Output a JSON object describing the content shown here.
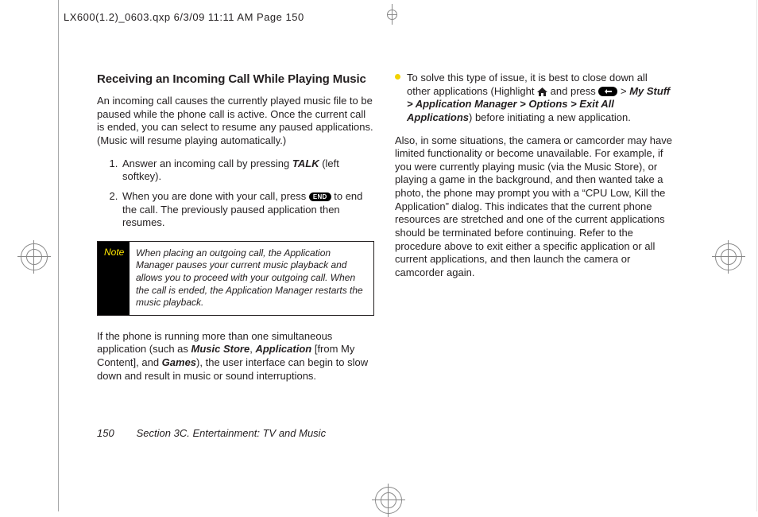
{
  "slug": "LX600(1.2)_0603.qxp  6/3/09  11:11 AM  Page 150",
  "heading": "Receiving an Incoming Call While Playing Music",
  "intro": "An incoming call causes the currently played music file to be paused while the phone call is active. Once the current call is ended, you can select to resume any paused applications. (Music will resume playing automatically.)",
  "steps": {
    "s1_a": "Answer an incoming call by pressing ",
    "s1_talk": "TALK",
    "s1_b": " (left softkey).",
    "s2_a": "When you are done with your call, press ",
    "s2_end": "END",
    "s2_b": " to end the call. The previously paused application then resumes."
  },
  "note": {
    "label": "Note",
    "body": "When placing an outgoing call, the Application Manager pauses your current music playback and allows you to proceed with your outgoing call. When the call is ended, the Application Manager restarts the music playback."
  },
  "ifphone": {
    "a": "If the phone is running more than one simultaneous application (such as ",
    "ms": "Music Store",
    "b": ", ",
    "app": "Application",
    "c": " [from My Content], and ",
    "games": "Games",
    "d": "), the user interface can begin to slow down and result in music or sound interruptions."
  },
  "bullet": {
    "a": "To solve this type of issue, it is best to close down all other applications (Highlight ",
    "b": " and press ",
    "c": " > ",
    "path": "My Stuff > Application Manager > Options > Exit All Applications",
    "d": ") before initiating a new application."
  },
  "also": "Also, in some situations, the camera or camcorder may have limited functionality or become unavailable. For example, if you were currently playing music (via the Music Store), or playing a game in the background, and then wanted take a photo, the phone may prompt you with a “CPU Low, Kill the Application” dialog. This indicates that the current phone resources are stretched and one of the current applications should be terminated before continuing. Refer to the procedure above to exit either a specific application or all current applications, and then launch the camera or camcorder again.",
  "footer": {
    "page": "150",
    "section": "Section 3C. Entertainment: TV and Music"
  }
}
